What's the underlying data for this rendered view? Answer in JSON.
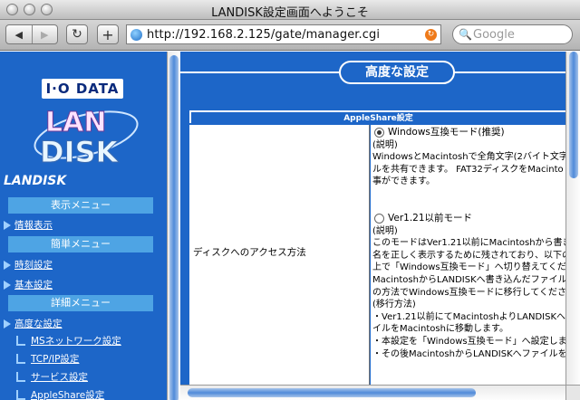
{
  "window": {
    "title": "LANDISK設定画面へようこそ"
  },
  "toolbar": {
    "url": "http://192.168.2.125/gate/manager.cgi",
    "search_placeholder": "Google",
    "back_label": "◀",
    "forward_label": "▶",
    "reload_label": "↻",
    "add_label": "+"
  },
  "sidebar": {
    "logo_text": "I·O DATA",
    "logo_land": "LAN",
    "logo_disk": "DISK",
    "brand": "LANDISK",
    "sections": [
      {
        "header": "表示メニュー",
        "items": [
          {
            "label": "情報表示"
          }
        ]
      },
      {
        "header": "簡単メニュー",
        "items": [
          {
            "label": "時刻設定"
          },
          {
            "label": "基本設定"
          }
        ]
      },
      {
        "header": "詳細メニュー",
        "items": [
          {
            "label": "高度な設定"
          }
        ],
        "subitems": [
          {
            "label": "MSネットワーク設定"
          },
          {
            "label": "TCP/IP設定"
          },
          {
            "label": "サービス設定"
          },
          {
            "label": "AppleShare設定"
          }
        ]
      }
    ]
  },
  "main": {
    "page_title": "高度な設定",
    "section_title": "AppleShare設定",
    "row_label": "ディスクへのアクセス方法",
    "option1": {
      "label": "Windows互換モード(推奨)",
      "selected": true,
      "desc_lines": [
        "(説明)",
        "WindowsとMacintoshで全角文字(2バイト文字",
        "ルを共有できます。 FAT32ディスクをMacinto",
        "事ができます。"
      ]
    },
    "option2": {
      "label": "Ver1.21以前モード",
      "selected": false,
      "desc_lines": [
        "(説明)",
        "このモードはVer1.21以前にMacintoshから書き",
        "名を正しく表示するために残されており、以下の",
        "上で「Windows互換モード」へ切り替えてくださ",
        "MacintoshからLANDISKへ書き込んだファイル",
        "の方法でWindows互換モードに移行してください",
        "(移行方法)",
        "・Ver1.21以前にてMacintoshよりLANDISKへ",
        "イルをMacintoshに移動します。",
        "・本設定を「Windows互換モード」へ設定しま",
        "・その後MacintoshからLANDISKへファイルを"
      ]
    }
  },
  "colors": {
    "frame_blue": "#1d66c8",
    "menu_header": "#4ea4e4"
  }
}
